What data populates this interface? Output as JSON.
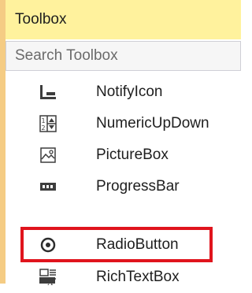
{
  "panel": {
    "title": "Toolbox",
    "search_placeholder": "Search Toolbox",
    "items": [
      {
        "label": "NotifyIcon",
        "icon": "notifyicon-icon"
      },
      {
        "label": "NumericUpDown",
        "icon": "numericupdown-icon"
      },
      {
        "label": "PictureBox",
        "icon": "picturebox-icon"
      },
      {
        "label": "ProgressBar",
        "icon": "progressbar-icon"
      },
      {
        "label": "RadioButton",
        "icon": "radiobutton-icon",
        "highlighted": true
      },
      {
        "label": "RichTextBox",
        "icon": "richtextbox-icon"
      }
    ]
  },
  "colors": {
    "title_background": "#fff29d",
    "left_border": "#f5cc84",
    "highlight_border": "#e0141d",
    "text": "#1e1e1e"
  }
}
